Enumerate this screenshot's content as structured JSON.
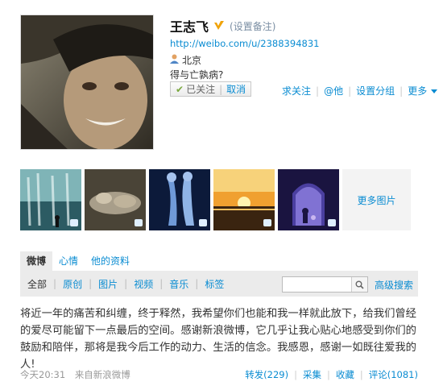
{
  "profile": {
    "name": "王志飞",
    "remark_link": "(设置备注)",
    "url": "http://weibo.com/u/2388394831",
    "location": "北京",
    "bio": "得与亡孰病?",
    "followed_label": "已关注",
    "unfollow_label": "取消"
  },
  "actions": {
    "quiet_follow": "求关注",
    "mention": "@他",
    "set_group": "设置分组",
    "more": "更多"
  },
  "photos": {
    "more_label": "更多图片"
  },
  "tabs": [
    {
      "label": "微博"
    },
    {
      "label": "心情"
    },
    {
      "label": "他的资料"
    }
  ],
  "filters": [
    {
      "label": "全部"
    },
    {
      "label": "原创"
    },
    {
      "label": "图片"
    },
    {
      "label": "视频"
    },
    {
      "label": "音乐"
    },
    {
      "label": "标签"
    }
  ],
  "search": {
    "value": "",
    "advanced_label": "高级搜索"
  },
  "post": {
    "text": "将近一年的痛苦和纠缠，终于释然，我希望你们也能和我一样就此放下，给我们曾经的爱尽可能留下一点最后的空间。感谢新浪微博，它几乎让我心贴心地感受到你们的鼓励和陪伴，那将是我今后工作的动力、生活的信念。我感恩，感谢一如既往爱我的人!",
    "time": "今天20:31",
    "source": "来自新浪微博",
    "repost": "转发(229)",
    "favorite": "收藏",
    "collect": "采集",
    "comment": "评论(1081)"
  },
  "colors": {
    "link": "#0a8cd2",
    "tab_bg": "#ebebeb",
    "verified": "#f0a30a"
  }
}
